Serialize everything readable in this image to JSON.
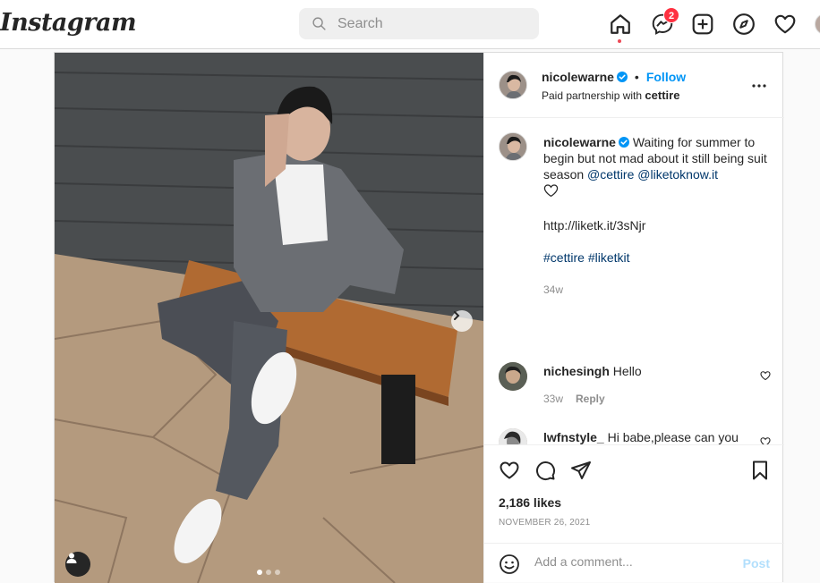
{
  "app": {
    "logo": "Instagram"
  },
  "search": {
    "placeholder": "Search"
  },
  "nav": {
    "icons": [
      "home-icon",
      "messenger-icon",
      "new-post-icon",
      "explore-icon",
      "activity-heart-icon"
    ],
    "messages_badge": "2"
  },
  "post": {
    "author": "nicolewarne",
    "follow_label": "Follow",
    "partnership_prefix": "Paid partnership with",
    "partner": "cettire",
    "caption": {
      "username": "nicolewarne",
      "text": "Waiting for summer to begin but not mad about it still being suit season",
      "mention1": "@cettire",
      "mention2": "@liketoknow.it",
      "link": "http://liketk.it/3sNjr",
      "tag1": "#cettire",
      "tag2": "#liketkit",
      "age": "34w"
    },
    "comments": [
      {
        "username": "nichesingh",
        "text": "Hello",
        "age": "33w",
        "reply": "Reply"
      },
      {
        "username": "lwfnstyle_",
        "text": "Hi babe,please can you help🙏🙏🙏 Does cettire site really exists? I made order but no one answers and I found a lot of scary"
      }
    ],
    "likes": "2,186 likes",
    "date": "NOVEMBER 26, 2021",
    "carousel": {
      "slides": 3,
      "active_slide": 1
    }
  },
  "add_comment": {
    "placeholder": "Add a comment...",
    "post_label": "Post"
  },
  "colors": {
    "link_blue": "#0095f6",
    "tag_blue": "#00376b",
    "badge_red": "#ff3040"
  }
}
